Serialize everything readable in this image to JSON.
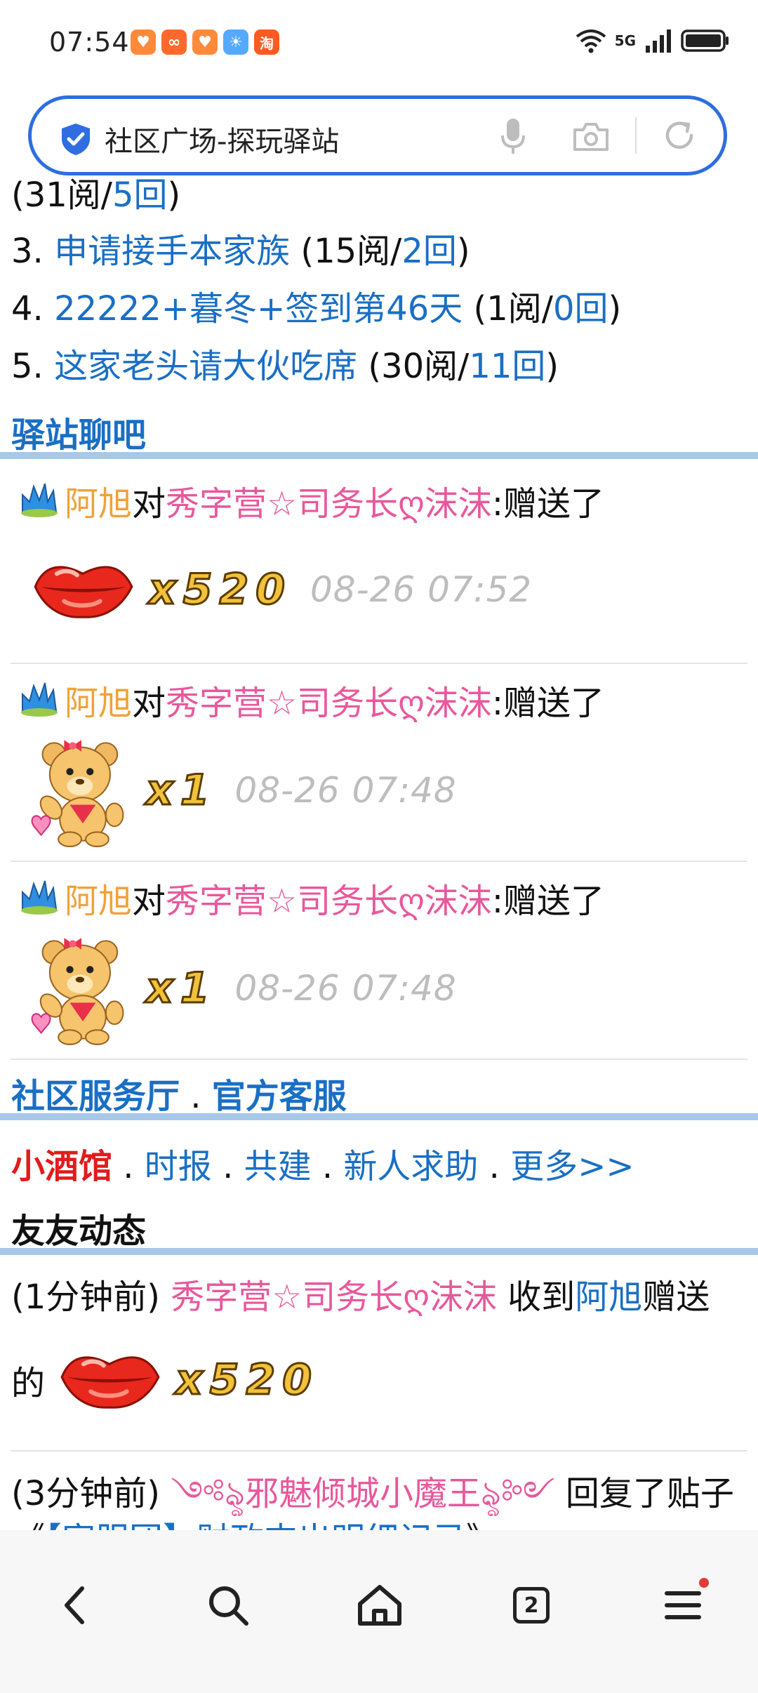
{
  "status_bar": {
    "time": "07:54",
    "network": "5G",
    "app_icons": [
      {
        "name": "app-icon-1",
        "color": "#ff8a3c",
        "glyph": "♥"
      },
      {
        "name": "app-icon-2",
        "color": "#ff6a2c",
        "glyph": "∞"
      },
      {
        "name": "app-icon-3",
        "color": "#ff8a3c",
        "glyph": "♥"
      },
      {
        "name": "app-icon-4",
        "color": "#55aaff",
        "glyph": "☀"
      },
      {
        "name": "app-icon-5",
        "color": "#ff5a1f",
        "glyph": "淘"
      }
    ]
  },
  "address_bar": {
    "title": "社区广场-探玩驿站"
  },
  "hot_list": {
    "line_top_pre": "(31阅/",
    "line_top_reply": "5回",
    "line_top_post": ")",
    "items": [
      {
        "num": "3. ",
        "title": "申请接手本家族",
        "reads": " (15阅/",
        "replies": "2回",
        "close": ")"
      },
      {
        "num": "4. ",
        "title": "22222+暮冬+签到第46天",
        "reads": " (1阅/",
        "replies": "0回",
        "close": ")"
      },
      {
        "num": "5. ",
        "title": "这家老头请大伙吃席",
        "reads": " (30阅/",
        "replies": "11回",
        "close": ")"
      }
    ]
  },
  "chat_section": {
    "title": "驿站聊吧",
    "entries": [
      {
        "sender": "阿旭",
        "verb": " 对 ",
        "receiver": "秀字营☆司务长ღ沫沫",
        "action": ":赠送了",
        "gift": "kiss-lips",
        "quantity": "x520",
        "time": "08-26 07:52"
      },
      {
        "sender": "阿旭",
        "verb": " 对 ",
        "receiver": "秀字营☆司务长ღ沫沫",
        "action": ":赠送了",
        "gift": "teddy-bear",
        "quantity": "x1",
        "time": "08-26 07:48"
      },
      {
        "sender": "阿旭",
        "verb": " 对 ",
        "receiver": "秀字营☆司务长ღ沫沫",
        "action": ":赠送了",
        "gift": "teddy-bear",
        "quantity": "x1",
        "time": "08-26 07:48"
      }
    ]
  },
  "service_section": {
    "hall": "社区服务厅",
    "sep": " . ",
    "official": "官方客服"
  },
  "links_row": {
    "tavern": "小酒馆",
    "sep": " . ",
    "links": [
      "时报",
      "共建",
      "新人求助",
      "更多>>"
    ]
  },
  "friends_section": {
    "title": "友友动态",
    "activities": [
      {
        "time": "(1分钟前) ",
        "user": "秀字营☆司务长ღ沫沫",
        "mid": " 收到",
        "from": "阿旭",
        "end": "赠送",
        "line2": "的",
        "quantity": "x520"
      },
      {
        "time": "(3分钟前) ",
        "user": "༺ৡ邪魅倾城小魔王ৡ༻",
        "mid": " 回复了贴子",
        "post_open": "《",
        "post": "【家服团】财政支出明细记录",
        "post_close": "》。"
      }
    ]
  },
  "bottom_nav": {
    "tab_count": "2",
    "colors": {
      "accent": "#2f6de0",
      "link": "#1a6fc4",
      "pink": "#e8589c",
      "badge": "#e53935"
    }
  }
}
